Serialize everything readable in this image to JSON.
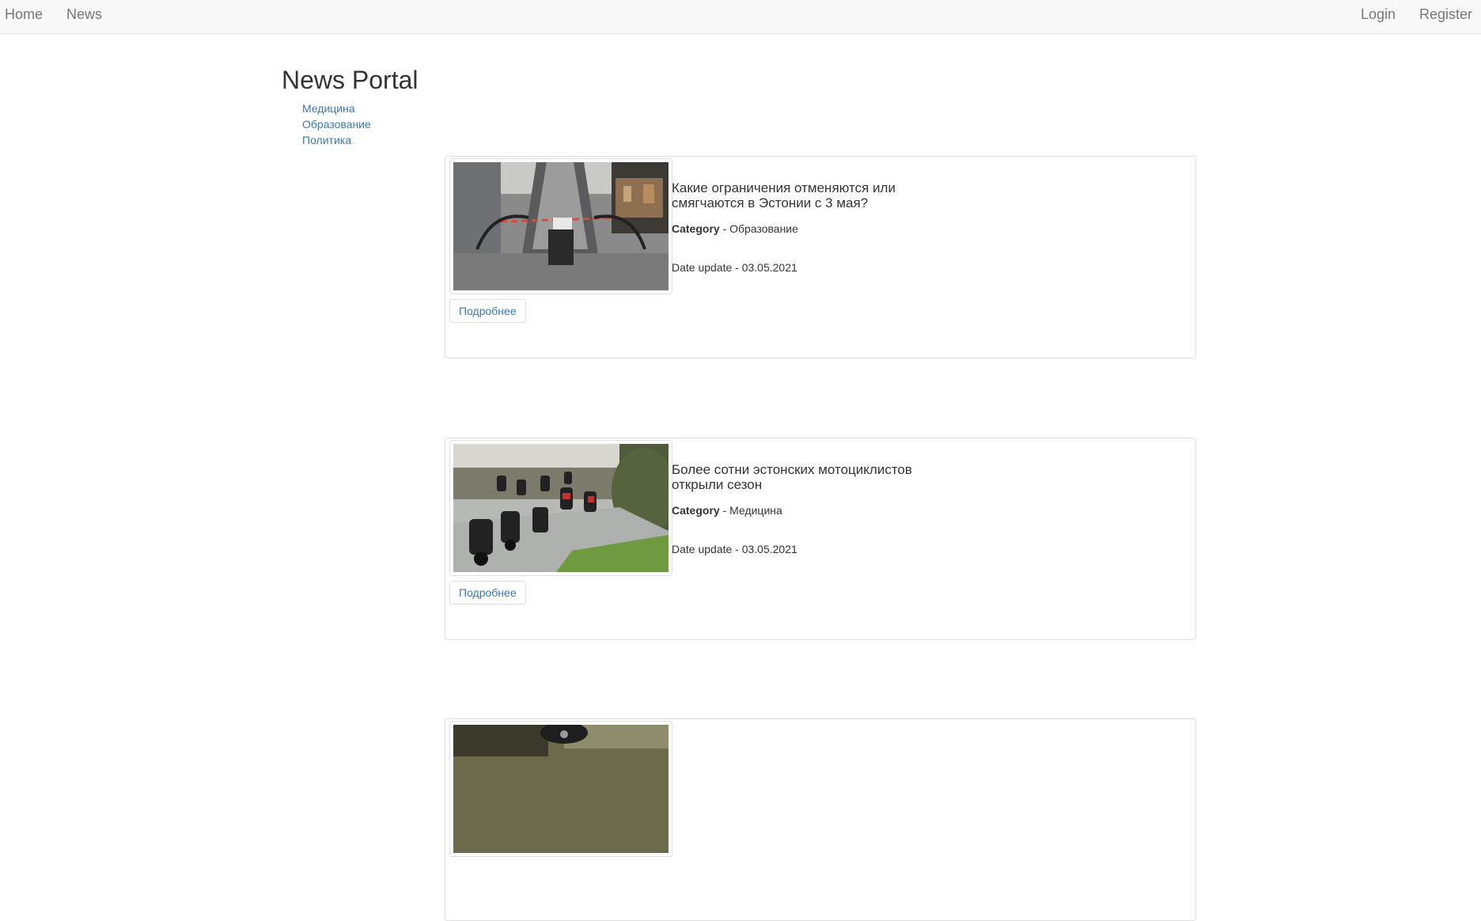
{
  "nav": {
    "home": "Home",
    "news": "News",
    "login": "Login",
    "register": "Register"
  },
  "header": {
    "title": "News Portal"
  },
  "categories": [
    "Медицина",
    "Образование",
    "Политика"
  ],
  "news": [
    {
      "title": "Какие ограничения отменяются или смягчаются в Эстонии с 3 мая?",
      "category_label": "Category",
      "category_sep": " - ",
      "category": "Образование",
      "date_text": "Date update - 03.05.2021",
      "more_label": "Подробнее"
    },
    {
      "title": "Более сотни эстонских мотоциклистов открыли сезон",
      "category_label": "Category",
      "category_sep": " - ",
      "category": "Медицина",
      "date_text": "Date update - 03.05.2021",
      "more_label": "Подробнее"
    }
  ]
}
